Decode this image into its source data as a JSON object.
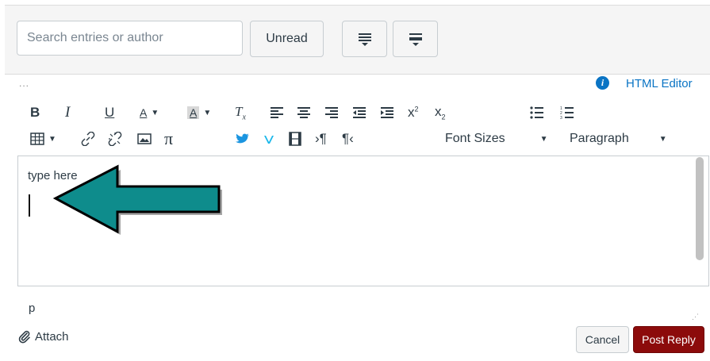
{
  "search": {
    "placeholder": "Search entries or author"
  },
  "filters": {
    "unread_label": "Unread"
  },
  "editor": {
    "more_label": "...",
    "html_editor_label": "HTML Editor",
    "font_sizes_label": "Font Sizes",
    "paragraph_label": "Paragraph",
    "content_text": "type here",
    "element_path": "p"
  },
  "footer": {
    "attach_label": "Attach",
    "cancel_label": "Cancel",
    "post_label": "Post Reply"
  },
  "colors": {
    "accent": "#0a74c4",
    "post_button": "#8c0b0b",
    "arrow": "#0e8c8c"
  },
  "icons": [
    "expand-all-icon",
    "collapse-all-icon",
    "info-icon",
    "bold-icon",
    "italic-icon",
    "underline-icon",
    "text-color-icon",
    "background-color-icon",
    "clear-formatting-icon",
    "align-left-icon",
    "align-center-icon",
    "align-right-icon",
    "outdent-icon",
    "indent-icon",
    "superscript-icon",
    "subscript-icon",
    "bullet-list-icon",
    "numbered-list-icon",
    "table-icon",
    "link-icon",
    "unlink-icon",
    "image-icon",
    "math-icon",
    "twitter-icon",
    "vimeo-icon",
    "media-icon",
    "ltr-icon",
    "rtl-icon",
    "paperclip-icon",
    "arrow-annotation"
  ]
}
